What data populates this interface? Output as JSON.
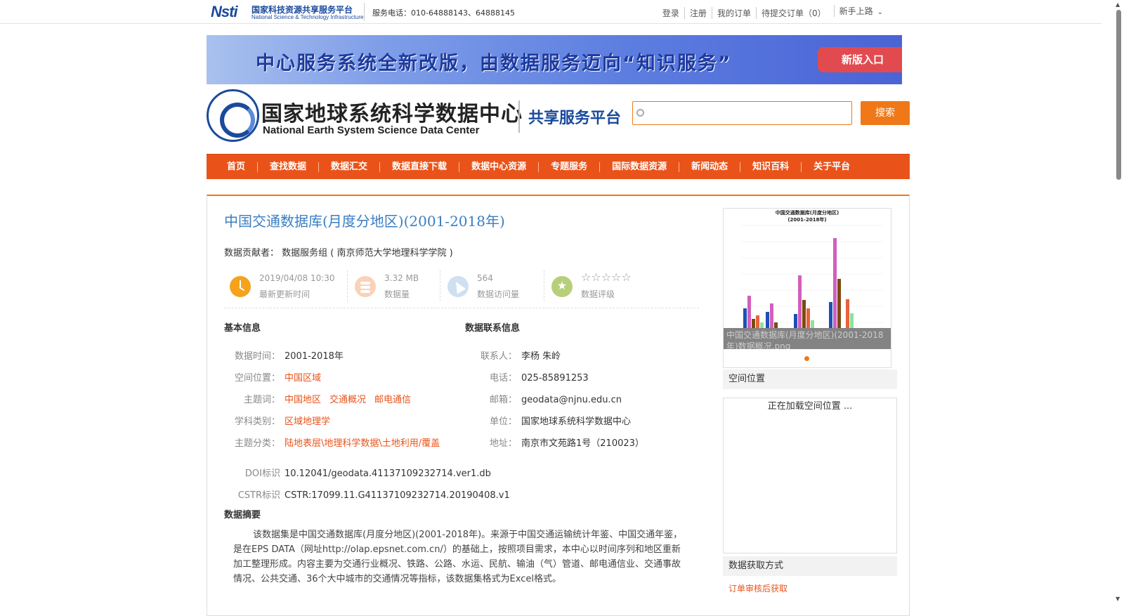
{
  "topbar": {
    "logo_mark": "Nsti",
    "logo_cn": "国家科技资源共享服务平台",
    "logo_en": "National Science & Technology Infrastructure",
    "phone": "服务电话：010-64888143、64888145",
    "links": [
      "登录",
      "注册",
      "我的订单",
      "待提交订单（0）"
    ],
    "newbie": "新手上路"
  },
  "banner": {
    "text": "中心服务系统全新改版，由数据服务迈向“知识服务”",
    "button": "新版入口"
  },
  "header": {
    "title_cn": "国家地球系统科学数据中心",
    "title_en": "National Earth System Science Data Center",
    "subtitle": "共享服务平台",
    "search_placeholder": "",
    "search_button": "搜索"
  },
  "nav": [
    "首页",
    "查找数据",
    "数据汇交",
    "数据直接下载",
    "数据中心资源",
    "专题服务",
    "国际数据资源",
    "新闻动态",
    "知识百科",
    "关于平台"
  ],
  "dataset": {
    "title": "中国交通数据库(月度分地区)(2001-2018年)",
    "contributor_label": "数据贡献者：",
    "contributor": "数据服务组 ( 南京师范大学地理科学学院 )",
    "stats": [
      {
        "value": "2019/04/08 10:30",
        "label": "最新更新时间"
      },
      {
        "value": "3.32 MB",
        "label": "数据量"
      },
      {
        "value": "564",
        "label": "数据访问量"
      },
      {
        "value": "☆☆☆☆☆",
        "label": "数据评级"
      }
    ],
    "basic_title": "基本信息",
    "basic": {
      "time_k": "数据时间：",
      "time_v": "2001-2018年",
      "space_k": "空间位置：",
      "space_v": "中国区域",
      "kw_k": "主题词：",
      "kw_1": "中国地区",
      "kw_2": "交通概况",
      "kw_3": "邮电通信",
      "subj_k": "学科类别：",
      "subj_v": "区域地理学",
      "cat_k": "主题分类：",
      "cat_v": "陆地表层\\地理科学数据\\土地利用/覆盖",
      "doi_k": "DOI标识",
      "doi_v": "10.12041/geodata.41137109232714.ver1.db",
      "cstr_k": "CSTR标识",
      "cstr_v": "CSTR:17099.11.G41137109232714.20190408.v1"
    },
    "contact_title": "数据联系信息",
    "contact": {
      "person_k": "联系人：",
      "person_v": "李杨 朱岭",
      "tel_k": "电话：",
      "tel_v": "025-85891253",
      "mail_k": "邮箱：",
      "mail_v": "geodata@njnu.edu.cn",
      "unit_k": "单位：",
      "unit_v": "国家地球系统科学数据中心",
      "addr_k": "地址：",
      "addr_v": "南京市文苑路1号（210023）"
    },
    "abstract_title": "数据摘要",
    "abstract": "该数据集是中国交通数据库(月度分地区)(2001-2018年)。来源于中国交通运输统计年鉴、中国交通年鉴，是在EPS DATA（网址http://olap.epsnet.com.cn/）的基础上，按照项目需求，本中心以时间序列和地区重新加工整理形成。内容主要为交通行业概况、铁路、公路、水运、民航、输油（气）管道、邮电通信业、交通事故情况、公共交通、36个大中城市的交通情况等指标，该数据集格式为Excel格式。"
  },
  "sidebar": {
    "thumb_title": "中国交通数据库(月度分地区)",
    "thumb_subtitle": "(2001-2018年)",
    "thumb_caption": "中国交通数据库(月度分地区)(2001-2018年)数据概况.png",
    "space_title": "空间位置",
    "space_loading": "正在加载空间位置 ...",
    "access_title": "数据获取方式",
    "access_value": "订单审核后获取"
  },
  "colors": {
    "accent": "#e9531a",
    "orange": "#f07818",
    "link_blue": "#3a7ec2"
  }
}
